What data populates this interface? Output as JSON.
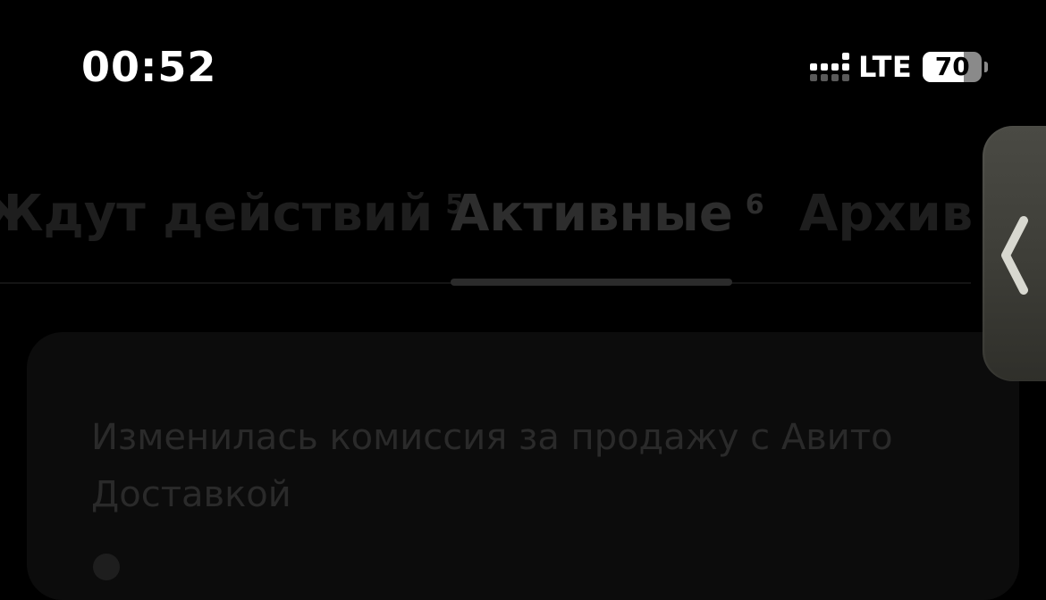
{
  "status_bar": {
    "time": "00:52",
    "network": "LTE",
    "battery_percent": 70,
    "battery_label": "70",
    "signal_icon": "cellular-signal-icon"
  },
  "tabs": [
    {
      "label": "Ждут действий",
      "count": "5",
      "active": false
    },
    {
      "label": "Активные",
      "count": "6",
      "active": true
    },
    {
      "label": "Архив",
      "count": "",
      "active": false
    }
  ],
  "card": {
    "message": "Изменилась комиссия за продажу с Авито Доставкой"
  },
  "side_handle": {
    "icon": "chevron-left-icon"
  },
  "colors": {
    "background": "#000000",
    "handle": "#3d3d37"
  }
}
